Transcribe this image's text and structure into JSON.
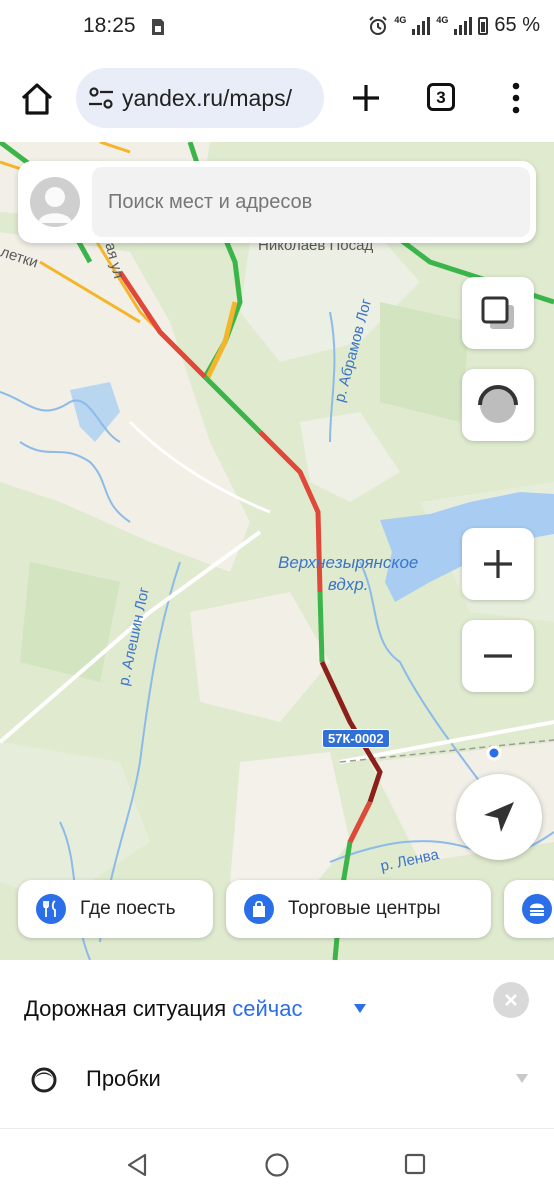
{
  "status_bar": {
    "time": "18:25",
    "network_1": "4G",
    "network_2": "4G",
    "battery": "65 %"
  },
  "browser": {
    "url": "yandex.ru/maps/",
    "tab_count": "3"
  },
  "search": {
    "placeholder": "Поиск мест и адресов"
  },
  "map": {
    "labels": {
      "nikolaev_posad": "Николаев Посад",
      "letki": "летки",
      "street": "ая ул",
      "river_abramov": "р. Абрамов Лог",
      "reservoir": "Верхнезырянское",
      "reservoir_2": "вдхр.",
      "river_aleshin": "р. Алешин Лог",
      "river_lenva": "р. Ленва",
      "road_code": "57К-0002"
    },
    "colors": {
      "traffic_green": "#3bb54a",
      "traffic_yellow": "#f5b52a",
      "traffic_red": "#e0483a",
      "traffic_darkred": "#8c1f1a",
      "water": "#a9cdf2",
      "forest": "#d8e8c8",
      "open_area": "#f0eee6"
    }
  },
  "map_controls": {
    "layers_icon": "layers-icon",
    "traffic_icon": "traffic-icon",
    "zoom_in_icon": "plus-icon",
    "zoom_out_icon": "minus-icon",
    "locate_icon": "navigation-arrow-icon"
  },
  "categories": [
    {
      "label": "Где поесть",
      "icon": "fork-knife-icon"
    },
    {
      "label": "Торговые центры",
      "icon": "shopping-bag-icon"
    },
    {
      "label": "",
      "icon": "burger-icon"
    }
  ],
  "sheet": {
    "title": "Дорожная ситуация",
    "now": "сейчас",
    "traffic_label": "Пробки"
  },
  "accent_color": "#2a6ee8"
}
